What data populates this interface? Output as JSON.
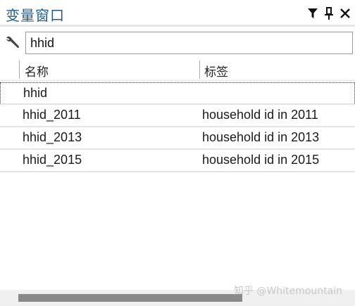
{
  "window": {
    "title": "变量窗口",
    "tools": {
      "filter_icon": "filter-icon",
      "pin_icon": "pin-icon",
      "close_icon": "close-icon"
    }
  },
  "search": {
    "icon": "wrench-icon",
    "value": "hhid"
  },
  "columns": {
    "name": "名称",
    "label": "标签"
  },
  "rows": [
    {
      "name": "hhid",
      "label": ""
    },
    {
      "name": "hhid_2011",
      "label": "household id in 2011"
    },
    {
      "name": "hhid_2013",
      "label": "household id in 2013"
    },
    {
      "name": "hhid_2015",
      "label": "household id in 2015"
    }
  ],
  "watermark": "知乎 @Whitemountain",
  "colors": {
    "title": "#1e5a8c",
    "scroll_thumb": "#8a8a8a"
  }
}
